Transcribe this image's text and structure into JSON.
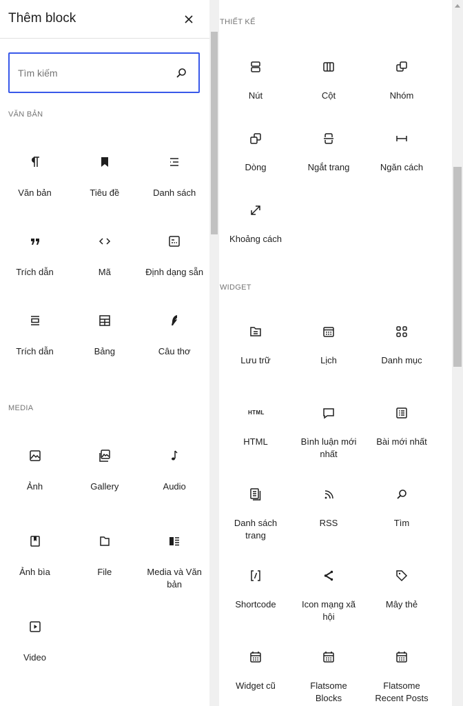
{
  "header": {
    "title": "Thêm block"
  },
  "search": {
    "placeholder": "Tìm kiếm"
  },
  "left": {
    "sections": [
      {
        "title": "VĂN BẢN",
        "items": [
          {
            "label": "Văn bản",
            "icon": "paragraph-icon"
          },
          {
            "label": "Tiêu đề",
            "icon": "bookmark-icon"
          },
          {
            "label": "Danh sách",
            "icon": "list-icon"
          },
          {
            "label": "Trích dẫn",
            "icon": "quote-icon"
          },
          {
            "label": "Mã",
            "icon": "code-icon"
          },
          {
            "label": "Định dạng sẵn",
            "icon": "preformatted-icon"
          },
          {
            "label": "Trích dẫn",
            "icon": "pullquote-icon"
          },
          {
            "label": "Bảng",
            "icon": "table-icon"
          },
          {
            "label": "Câu thơ",
            "icon": "verse-icon"
          }
        ]
      },
      {
        "title": "MEDIA",
        "items": [
          {
            "label": "Ảnh",
            "icon": "image-icon"
          },
          {
            "label": "Gallery",
            "icon": "gallery-icon"
          },
          {
            "label": "Audio",
            "icon": "audio-icon"
          },
          {
            "label": "Ảnh bìa",
            "icon": "cover-icon"
          },
          {
            "label": "File",
            "icon": "file-icon"
          },
          {
            "label": "Media và Văn bản",
            "icon": "media-text-icon"
          },
          {
            "label": "Video",
            "icon": "video-icon"
          }
        ]
      }
    ]
  },
  "right": {
    "sections": [
      {
        "title": "THIẾT KẾ",
        "items": [
          {
            "label": "Nút",
            "icon": "buttons-icon"
          },
          {
            "label": "Cột",
            "icon": "columns-icon"
          },
          {
            "label": "Nhóm",
            "icon": "group-icon"
          },
          {
            "label": "Dòng",
            "icon": "row-icon"
          },
          {
            "label": "Ngắt trang",
            "icon": "page-break-icon"
          },
          {
            "label": "Ngăn cách",
            "icon": "separator-icon"
          },
          {
            "label": "Khoảng cách",
            "icon": "spacer-icon"
          }
        ]
      },
      {
        "title": "WIDGET",
        "items": [
          {
            "label": "Lưu trữ",
            "icon": "archive-icon"
          },
          {
            "label": "Lịch",
            "icon": "calendar-icon"
          },
          {
            "label": "Danh mục",
            "icon": "categories-icon"
          },
          {
            "label": "HTML",
            "icon": "html-icon",
            "icon_text": "HTML"
          },
          {
            "label": "Bình luận mới nhất",
            "icon": "comment-icon"
          },
          {
            "label": "Bài mới nhất",
            "icon": "latest-posts-icon"
          },
          {
            "label": "Danh sách trang",
            "icon": "page-list-icon"
          },
          {
            "label": "RSS",
            "icon": "rss-icon"
          },
          {
            "label": "Tìm",
            "icon": "search-icon"
          },
          {
            "label": "Shortcode",
            "icon": "shortcode-icon"
          },
          {
            "label": "Icon mạng xã hội",
            "icon": "share-icon"
          },
          {
            "label": "Mây thẻ",
            "icon": "tag-icon"
          },
          {
            "label": "Widget cũ",
            "icon": "legacy-widget-icon"
          },
          {
            "label": "Flatsome Blocks",
            "icon": "flatsome-blocks-icon"
          },
          {
            "label": "Flatsome Recent Posts",
            "icon": "flatsome-recent-posts-icon"
          }
        ]
      }
    ]
  }
}
